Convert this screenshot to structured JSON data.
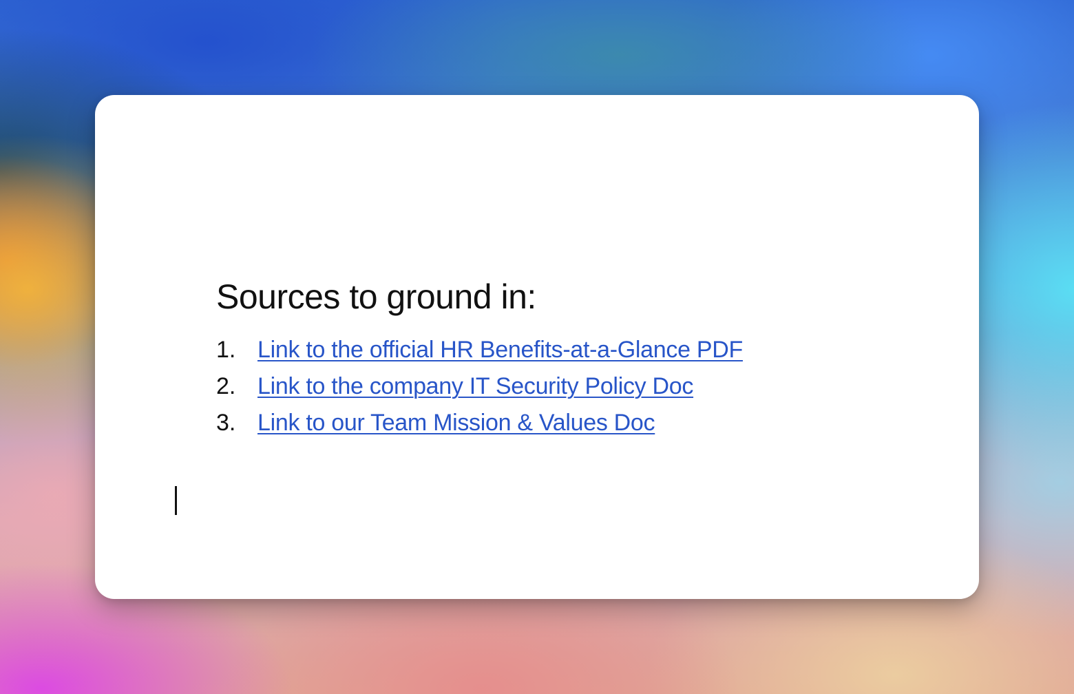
{
  "document": {
    "heading": "Sources to ground in:",
    "sources": [
      {
        "number": "1.",
        "label": "Link to the official HR Benefits-at-a-Glance PDF"
      },
      {
        "number": "2.",
        "label": "Link to the company IT Security Policy Doc"
      },
      {
        "number": "3.",
        "label": "Link to our Team Mission & Values Doc"
      }
    ]
  },
  "colors": {
    "link": "#2855c8",
    "text": "#111111",
    "card": "#ffffff"
  }
}
